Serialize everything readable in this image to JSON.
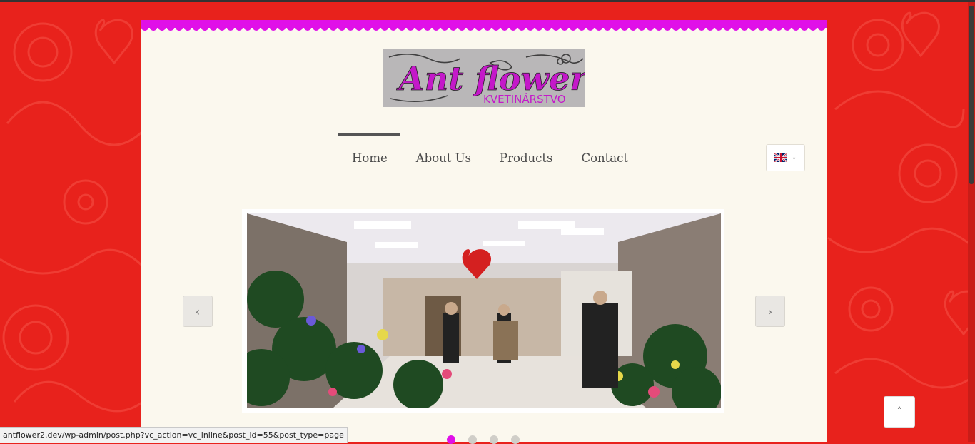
{
  "logo": {
    "title": "Ant flower",
    "subtitle": "KVETINÁRSTVO",
    "sign_text": "Ant flower"
  },
  "nav": {
    "items": [
      {
        "label": "Home",
        "active": true
      },
      {
        "label": "About Us",
        "active": false
      },
      {
        "label": "Products",
        "active": false
      },
      {
        "label": "Contact",
        "active": false
      }
    ]
  },
  "language": {
    "current": "uk-flag-icon",
    "chevron": "⌄"
  },
  "slider": {
    "prev_icon": "‹",
    "next_icon": "›",
    "slide_count": 4,
    "active_index": 0
  },
  "back_to_top_icon": "˄",
  "status_bar": {
    "url": "antflower2.dev/wp-admin/post.php?vc_action=vc_inline&post_id=55&post_type=page"
  },
  "colors": {
    "background": "#e8221c",
    "accent": "#e010e8",
    "page": "#fbf8ee",
    "text": "#4a4a4a"
  }
}
